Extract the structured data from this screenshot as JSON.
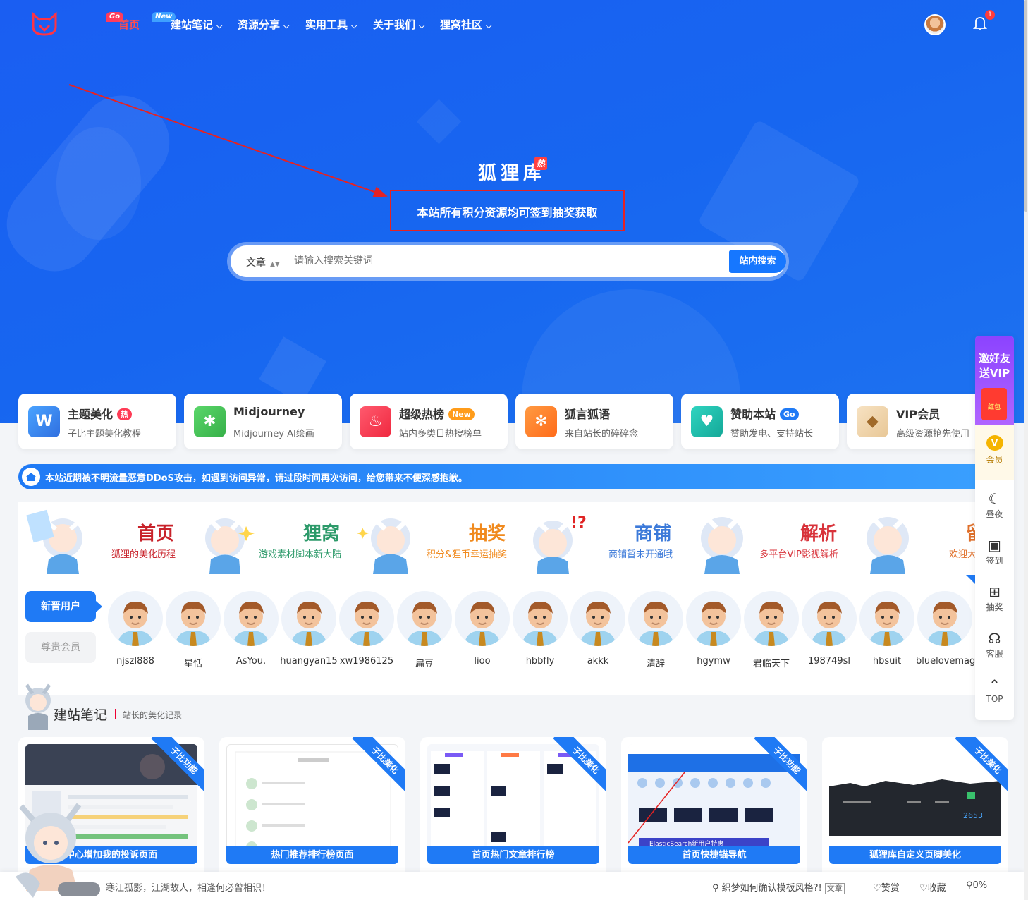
{
  "nav": {
    "home": "首页",
    "home_tag": "Go",
    "new_tag": "New",
    "items": [
      {
        "label": "建站笔记"
      },
      {
        "label": "资源分享"
      },
      {
        "label": "实用工具"
      },
      {
        "label": "关于我们"
      },
      {
        "label": "狸窝社区"
      }
    ],
    "notification_count": "1"
  },
  "hero": {
    "site_name": "狐狸库",
    "hot_mark": "热",
    "subtitle": "本站所有积分资源均可签到抽奖获取"
  },
  "search": {
    "type": "文章",
    "placeholder": "请输入搜索关键词",
    "button": "站内搜索"
  },
  "cards": [
    {
      "title": "主题美化",
      "badge": "热",
      "desc": "子比主题美化教程",
      "color": "#3f8cf5",
      "icon": "wordpress-icon"
    },
    {
      "title": "Midjourney",
      "badge": "",
      "desc": "Midjourney AI绘画",
      "color": "#4cc35e",
      "icon": "puzzle-icon"
    },
    {
      "title": "超级热榜",
      "badge": "New",
      "desc": "站内多类目热搜榜单",
      "color": "#ff3b55",
      "icon": "fire-icon"
    },
    {
      "title": "狐言狐语",
      "badge": "",
      "desc": "来自站长的碎碎念",
      "color": "#ff7e2d",
      "icon": "yelp-icon"
    },
    {
      "title": "赞助本站",
      "badge": "Go",
      "desc": "赞助发电、支持站长",
      "color": "#1cbfb0",
      "icon": "heartbeat-icon"
    },
    {
      "title": "VIP会员",
      "badge": "",
      "desc": "高级资源抢先使用",
      "color": "#f2d8b4",
      "icon": "diamond-icon"
    }
  ],
  "notice": "本站近期被不明流量恶意DDoS攻击，如遇到访问异常，请过段时间再次访问，给您带来不便深感抱歉。",
  "features": [
    {
      "title": "首页",
      "desc": "狐狸的美化历程",
      "color": "#c8222a"
    },
    {
      "title": "狸窝",
      "desc": "游戏素材脚本新大陆",
      "color": "#2d9a6a"
    },
    {
      "title": "抽奖",
      "desc": "积分&狸币幸运抽奖",
      "color": "#f08a1e"
    },
    {
      "title": "商铺",
      "desc": "商铺暂未开通哦",
      "color": "#3c7ad9"
    },
    {
      "title": "解析",
      "desc": "多平台VIP影视解析",
      "color": "#d8323a"
    },
    {
      "title": "留言",
      "desc": "欢迎大家留言",
      "color": "#e0702a"
    }
  ],
  "users": {
    "tab_new": "新晋用户",
    "tab_vip": "尊贵会员",
    "list": [
      "njszl888",
      "星恬",
      "AsYou.",
      "huangyan15",
      "xw1986125",
      "扁豆",
      "lioo",
      "hbbfly",
      "akkk",
      "清辞",
      "hgymw",
      "君临天下",
      "198749sl",
      "hbsuit",
      "bluelovemag"
    ]
  },
  "section": {
    "title": "建站笔记",
    "subtitle": "站长的美化记录"
  },
  "posts": [
    {
      "caption": "中心增加我的投诉页面",
      "ribbon": "子比功能"
    },
    {
      "caption": "热门推荐排行榜页面",
      "ribbon": "子比美化"
    },
    {
      "caption": "首页热门文章排行榜",
      "ribbon": "子比美化"
    },
    {
      "caption": "首页快捷锚导航",
      "ribbon": "子比功能"
    },
    {
      "caption": "狐狸库自定义页脚美化",
      "ribbon": "子比美化"
    }
  ],
  "post_thumb_text": {
    "search_banner": "ElasticSearch新用户特惠",
    "count": "2653"
  },
  "footer": {
    "quote": "寒江孤影，江湖故人，相逢何必曾相识！",
    "article": "织梦如何确认模板风格?!",
    "article_tag": "文章",
    "reward": "赞赏",
    "favorite": "收藏",
    "progress": "0%"
  },
  "sidebar": {
    "invite": "邀好友送VIP",
    "redpack": "红包",
    "vip": "会员",
    "vip_letter": "V",
    "items": [
      "昼夜",
      "签到",
      "抽奖",
      "客服",
      "TOP"
    ]
  }
}
